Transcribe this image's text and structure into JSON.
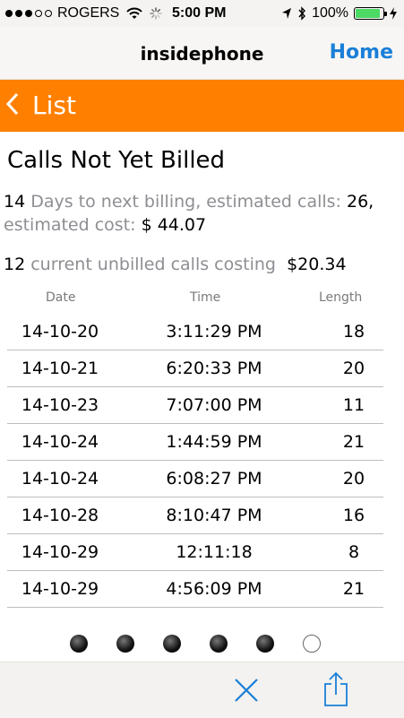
{
  "status_bar": {
    "carrier": "ROGERS",
    "time": "5:00 PM",
    "battery": "100%",
    "signal_dots_filled": 3,
    "signal_dots_total": 5
  },
  "nav": {
    "title": "insidephone",
    "home": "Home"
  },
  "back_bar": {
    "label": "List"
  },
  "page": {
    "title": "Calls Not Yet Billed",
    "days": "14",
    "days_text": " Days to next billing, estimated calls: ",
    "est_calls": "26",
    "comma": ",",
    "cost_text": "estimated cost: ",
    "est_cost": "$ 44.07",
    "unbilled_count": "12",
    "unbilled_text": " current unbilled calls costing ",
    "unbilled_cost": "$20.34"
  },
  "table": {
    "headers": [
      "Date",
      "Time",
      "Length"
    ],
    "rows": [
      [
        "14-10-20",
        "3:11:29 PM",
        "18"
      ],
      [
        "14-10-21",
        "6:20:33 PM",
        "20"
      ],
      [
        "14-10-23",
        "7:07:00 PM",
        "11"
      ],
      [
        "14-10-24",
        "1:44:59 PM",
        "21"
      ],
      [
        "14-10-24",
        "6:08:27 PM",
        "20"
      ],
      [
        "14-10-28",
        "8:10:47 PM",
        "16"
      ],
      [
        "14-10-29",
        "12:11:18",
        "8"
      ],
      [
        "14-10-29",
        "4:56:09 PM",
        "21"
      ]
    ]
  },
  "pager": {
    "pages": 6,
    "current": 6
  },
  "colors": {
    "accent_orange": "#ff8000",
    "link_blue": "#1a7fd8",
    "battery_green": "#4cd964",
    "toolbar_icon_blue": "#1a7fd8"
  },
  "icons": [
    "wifi-icon",
    "activity-spinner-icon",
    "location-arrow-icon",
    "bluetooth-icon",
    "battery-icon",
    "charging-bolt-icon",
    "back-chevron-icon",
    "close-icon",
    "share-icon"
  ]
}
